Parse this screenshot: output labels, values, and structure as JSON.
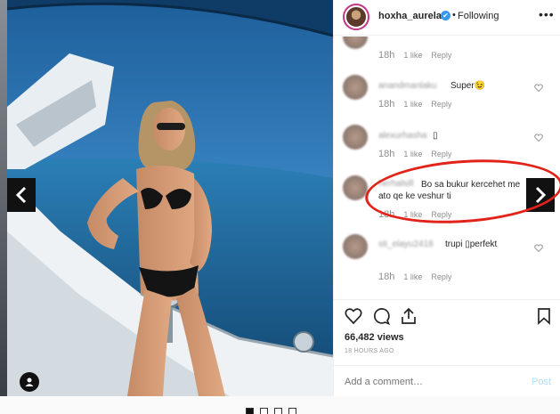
{
  "post": {
    "username": "hoxha_aurela",
    "follow_status": "Following",
    "separator": "•",
    "verified_glyph": "✔",
    "more_glyph": "•••"
  },
  "comments": [
    {
      "time": "18h",
      "likes": "1 like",
      "reply": "Reply",
      "name": "",
      "text": ""
    },
    {
      "time": "18h",
      "likes": "1 like",
      "reply": "Reply",
      "name": "anandmanlaku",
      "text": "Super😉"
    },
    {
      "time": "18h",
      "likes": "1 like",
      "reply": "Reply",
      "name": "alexurhasha",
      "text": "▯"
    },
    {
      "time": "18h",
      "likes": "1 like",
      "reply": "Reply",
      "name": "herhalsill",
      "text": "Bo sa bukur kercehet me ato qe ke veshur ti"
    },
    {
      "time": "18h",
      "likes": "1 like",
      "reply": "Reply",
      "name": "sti_elayu2418",
      "text": "trupi ▯perfekt"
    }
  ],
  "stats": {
    "views": "66,482 views",
    "time_ago": "18 HOURS AGO"
  },
  "add_comment": {
    "placeholder": "Add a comment…",
    "post_label": "Post"
  },
  "carousel": {
    "prev_icon": "chevron-left-icon",
    "next_icon": "chevron-right-icon",
    "active_index": 1,
    "count": 4
  },
  "colors": {
    "accent_blue": "#3897f0",
    "annotation_red": "#e2231a",
    "sea_blue": "#2d6da3"
  }
}
